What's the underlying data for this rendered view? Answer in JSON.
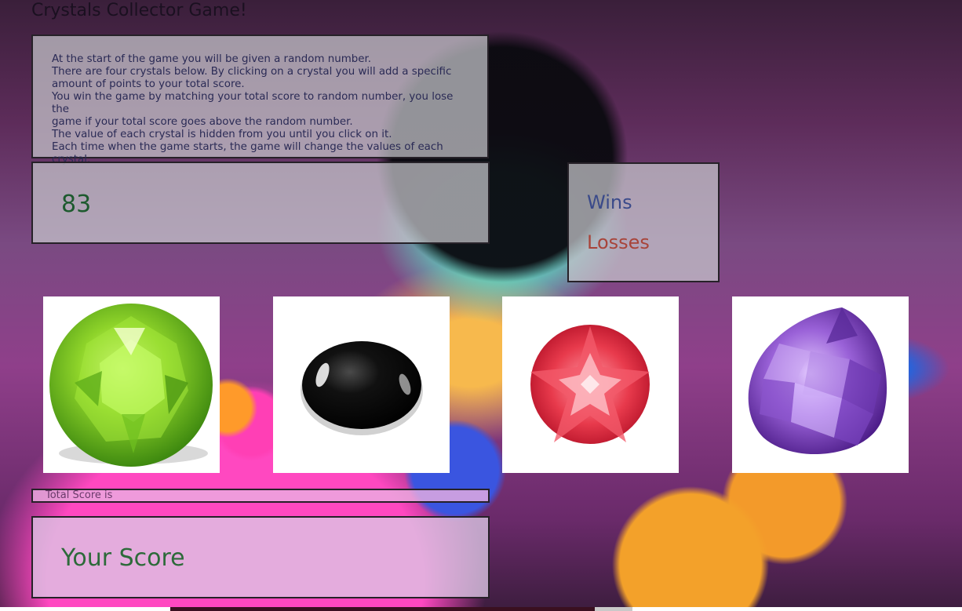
{
  "title": "Crystals Collector Game!",
  "instructions": [
    "At the start of the game you will be given a random number.",
    "There are four crystals below. By clicking on a crystal you will add a specific",
    "amount of points to your total score.",
    "You win the game by matching your total score to random number, you lose the",
    "game if your total score goes above the random number.",
    "The value of each crystal is hidden from you until you click on it.",
    "Each time when the game starts, the game will change the values of each crystal."
  ],
  "random_number": "83",
  "stats": {
    "wins_label": "Wins",
    "losses_label": "Losses"
  },
  "crystals": [
    {
      "name": "green peridot",
      "icon": "green-crystal-icon"
    },
    {
      "name": "black onyx",
      "icon": "black-crystal-icon"
    },
    {
      "name": "red ruby",
      "icon": "red-crystal-icon"
    },
    {
      "name": "purple amethyst",
      "icon": "purple-crystal-icon"
    }
  ],
  "total_score_label": "Total Score is",
  "score_placeholder": "Your Score",
  "colors": {
    "random_number": "#1d5a2e",
    "wins": "#3a4a8a",
    "losses": "#a8443a",
    "score": "#2d6a3a"
  }
}
